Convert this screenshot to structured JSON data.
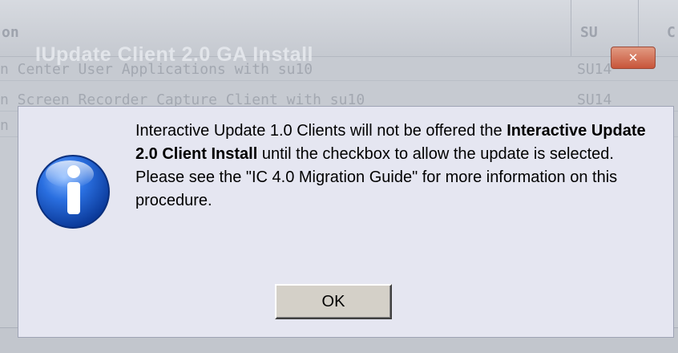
{
  "background": {
    "columns": [
      {
        "label": "on"
      },
      {
        "label": "SU"
      },
      {
        "label": "C"
      }
    ],
    "window_title": "IUpdate Client 2.0 GA Install",
    "close_label": "✕",
    "rows": [
      {
        "name": "n Center User Applications with su10",
        "su": "SU14"
      },
      {
        "name": "n Screen Recorder Capture Client with su10",
        "su": "SU14"
      },
      {
        "name": "n",
        "su": ""
      }
    ]
  },
  "dialog": {
    "message_part1": "Interactive Update 1.0 Clients will not be offered the ",
    "message_bold": "Interactive Update 2.0 Client Install",
    "message_part2": " until the checkbox to allow the update is selected. Please see the \"IC 4.0 Migration Guide\" for more information on this procedure.",
    "ok_label": "OK",
    "icon": "info-icon"
  },
  "colors": {
    "dialog_bg": "#e5e6f1",
    "icon_blue": "#1a5fd0",
    "close_red": "#c8553a"
  }
}
